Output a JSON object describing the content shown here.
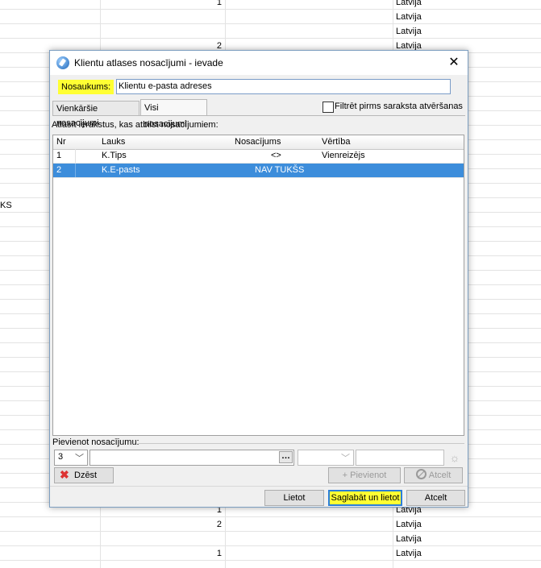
{
  "background": {
    "rows": [
      {
        "num": "1",
        "country": "Latvija",
        "side": ""
      },
      {
        "num": "",
        "country": "Latvija",
        "side": ""
      },
      {
        "num": "",
        "country": "Latvija",
        "side": ""
      },
      {
        "num": "2",
        "country": "Latvija",
        "side": ""
      },
      {
        "num": "",
        "country": "",
        "side": ""
      },
      {
        "num": "",
        "country": "",
        "side": ""
      },
      {
        "num": "",
        "country": "",
        "side": ""
      },
      {
        "num": "",
        "country": "",
        "side": ""
      },
      {
        "num": "",
        "country": "",
        "side": ""
      },
      {
        "num": "",
        "country": "",
        "side": ""
      },
      {
        "num": "",
        "country": "",
        "side": ""
      },
      {
        "num": "",
        "country": "",
        "side": ""
      },
      {
        "num": "",
        "country": "",
        "side": ""
      },
      {
        "num": "",
        "country": "",
        "side": ""
      },
      {
        "num": "",
        "country": "",
        "side": "KS"
      },
      {
        "num": "",
        "country": "",
        "side": ""
      },
      {
        "num": "",
        "country": "",
        "side": ""
      },
      {
        "num": "",
        "country": "",
        "side": ""
      },
      {
        "num": "",
        "country": "",
        "side": ""
      },
      {
        "num": "",
        "country": "",
        "side": ""
      },
      {
        "num": "",
        "country": "",
        "side": ""
      },
      {
        "num": "",
        "country": "",
        "side": ""
      },
      {
        "num": "",
        "country": "",
        "side": ""
      },
      {
        "num": "",
        "country": "",
        "side": ""
      },
      {
        "num": "",
        "country": "",
        "side": ""
      },
      {
        "num": "",
        "country": "",
        "side": ""
      },
      {
        "num": "",
        "country": "",
        "side": ""
      },
      {
        "num": "",
        "country": "",
        "side": ""
      },
      {
        "num": "",
        "country": "",
        "side": ""
      },
      {
        "num": "",
        "country": "",
        "side": ""
      },
      {
        "num": "",
        "country": "",
        "side": ""
      },
      {
        "num": "",
        "country": "",
        "side": ""
      },
      {
        "num": "",
        "country": "",
        "side": ""
      },
      {
        "num": "",
        "country": "",
        "side": ""
      },
      {
        "num": "",
        "country": "",
        "side": ""
      },
      {
        "num": "1",
        "country": "Latvija",
        "side": ""
      },
      {
        "num": "2",
        "country": "Latvija",
        "side": ""
      },
      {
        "num": "",
        "country": "Latvija",
        "side": ""
      },
      {
        "num": "1",
        "country": "Latvija",
        "side": ""
      }
    ]
  },
  "dialog": {
    "title": "Klientu atlases nosacījumi - ievade",
    "close_icon": "close-icon",
    "name_label": "Nosaukums:",
    "name_value": "Klientu e-pasta adreses",
    "tabs": [
      {
        "label": "Vienkāršie nosacījumi",
        "active": false
      },
      {
        "label": "Visi nosacījumi",
        "active": true
      }
    ],
    "filter_label": "Filtrēt pirms saraksta atvēršanas",
    "filter_checked": false,
    "panel_label": "Atlasīt ierakstus, kas atbilst nosacījumiem:",
    "columns": [
      "Nr",
      "Lauks",
      "Nosacījums",
      "Vērtība"
    ],
    "rows": [
      {
        "nr": "1",
        "field": "K.Tips",
        "condition": "<>",
        "value": "Vienreizējs",
        "selected": false
      },
      {
        "nr": "2",
        "field": "K.E-pasts",
        "condition": "NAV TUKŠS",
        "value": "",
        "selected": true
      }
    ],
    "add_label": "Pievienot nosacījumu:",
    "add_field_value": "3",
    "buttons": {
      "delete": "Dzēst",
      "add": "+ Pievienot",
      "cancel_condition": "Atcelt",
      "apply": "Lietot",
      "save_apply": "Saglabāt un lietot",
      "cancel": "Atcelt"
    }
  },
  "colors": {
    "highlight": "#ffff33",
    "selection": "#3c8ddb"
  }
}
